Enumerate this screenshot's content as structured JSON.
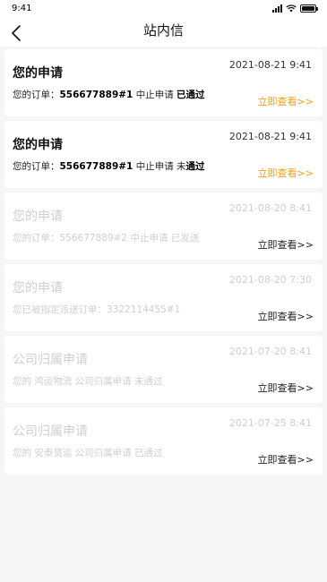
{
  "status_bar": {
    "time": "9:41"
  },
  "nav": {
    "title": "站内信"
  },
  "messages": [
    {
      "title": "您的申请",
      "time": "2021-08-21 9:41",
      "desc_prefix": "您的订单：",
      "desc_bold": "556677889#1",
      "desc_mid": " 中止申请 ",
      "desc_tail": "已通过",
      "link": "立即查看>>"
    },
    {
      "title": "您的申请",
      "time": "2021-08-21 9:41",
      "desc_prefix": "您的订单：",
      "desc_bold": "556677889#1",
      "desc_mid": " 中止申请 未",
      "desc_tail": "通过",
      "link": "立即查看>>"
    },
    {
      "title": "您的申请",
      "time": "2021-08-20 8:41",
      "desc": "您的订单：556677889#2 中止申请 已发送",
      "link": "立即查看>>"
    },
    {
      "title": "您的申请",
      "time": "2021-08-20 7:30",
      "desc": "您已被指定派送订单：3322114455#1",
      "link": "立即查看>>"
    },
    {
      "title": "公司归属申请",
      "time": "2021-07-20 8:41",
      "desc": "您的 鸿运物流 公司归属申请 未通过",
      "link": "立即查看>>"
    },
    {
      "title": "公司归属申请",
      "time": "2021-07-25 8:41",
      "desc": "您的 安泰货运 公司归属申请 已通过",
      "link": "立即查看>>"
    }
  ],
  "colors": {
    "link_accent": "#f5a30a",
    "read_text": "#cfcfcf",
    "background": "#f6f6f6"
  }
}
